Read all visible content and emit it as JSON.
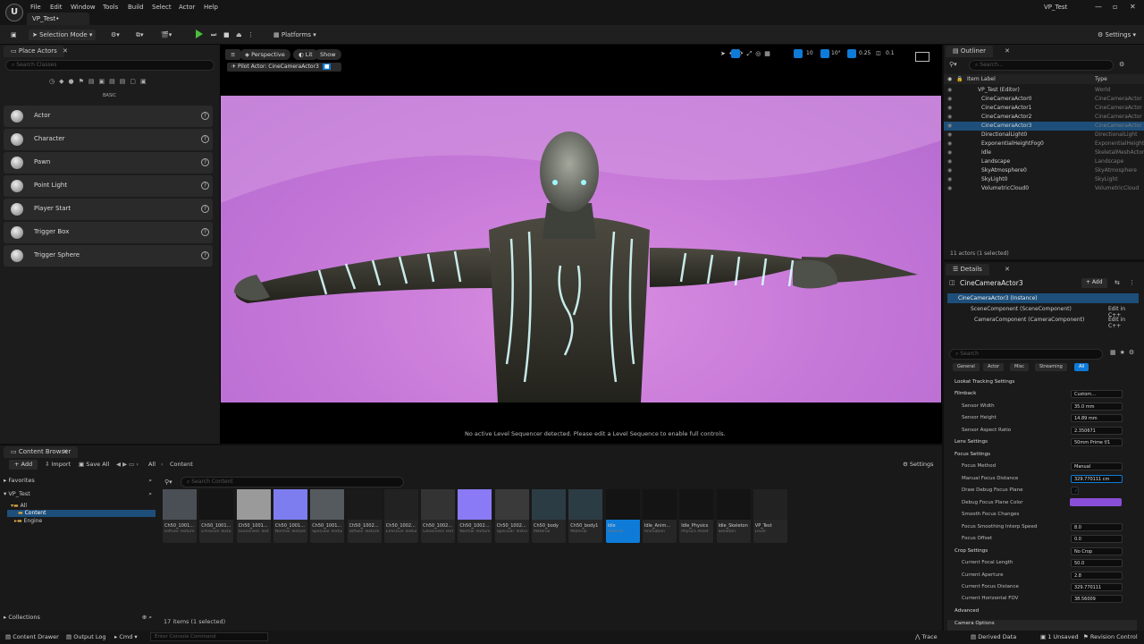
{
  "menu": [
    "File",
    "Edit",
    "Window",
    "Tools",
    "Build",
    "Select",
    "Actor",
    "Help"
  ],
  "project_tab": "VP_Test•",
  "window_title": "VP_Test",
  "toolbar": {
    "mode": "Selection Mode",
    "platforms": "Platforms",
    "settings": "Settings"
  },
  "place_actors": {
    "tab": "Place Actors",
    "search_placeholder": "Search Classes",
    "category": "BASIC",
    "items": [
      "Actor",
      "Character",
      "Pawn",
      "Point Light",
      "Player Start",
      "Trigger Box",
      "Trigger Sphere"
    ]
  },
  "viewport": {
    "perspective": "Perspective",
    "lit": "Lit",
    "show": "Show",
    "pilot": "Pilot Actor: CineCameraActor3",
    "grid": "10",
    "rot": "10°",
    "scale": "0.25",
    "cam": "0.1",
    "message": "No active Level Sequencer detected. Please edit a Level Sequence to enable full controls."
  },
  "outliner": {
    "tab": "Outliner",
    "search_placeholder": "Search...",
    "col_label": "Item Label",
    "col_type": "Type",
    "rows": [
      {
        "label": "VP_Test (Editor)",
        "type": "World"
      },
      {
        "label": "CineCameraActor0",
        "type": "CineCameraActor"
      },
      {
        "label": "CineCameraActor1",
        "type": "CineCameraActor"
      },
      {
        "label": "CineCameraActor2",
        "type": "CineCameraActor"
      },
      {
        "label": "CineCameraActor3",
        "type": "CineCameraActor"
      },
      {
        "label": "DirectionalLight0",
        "type": "DirectionalLight"
      },
      {
        "label": "ExponentialHeightFog0",
        "type": "ExponentialHeightFog"
      },
      {
        "label": "Idle",
        "type": "SkeletalMeshActor"
      },
      {
        "label": "Landscape",
        "type": "Landscape"
      },
      {
        "label": "SkyAtmosphere0",
        "type": "SkyAtmosphere"
      },
      {
        "label": "SkyLight0",
        "type": "SkyLight"
      },
      {
        "label": "VolumetricCloud0",
        "type": "VolumetricCloud"
      }
    ],
    "footer": "11 actors (1 selected)"
  },
  "details": {
    "tab": "Details",
    "actor": "CineCameraActor3",
    "add": "+ Add",
    "instance": "CineCameraActor3 (Instance)",
    "comp1": "SceneComponent (SceneComponent)",
    "comp2": "CameraComponent (CameraComponent)",
    "edit_cpp": "Edit in C++",
    "search_placeholder": "Search",
    "filters": [
      "General",
      "Actor",
      "Misc",
      "Streaming",
      "All"
    ],
    "rows": [
      {
        "label": "Lookat Tracking Settings",
        "value": ""
      },
      {
        "label": "Filmback",
        "value": "Custom..."
      },
      {
        "label": "Sensor Width",
        "value": "35.0 mm"
      },
      {
        "label": "Sensor Height",
        "value": "14.89 mm"
      },
      {
        "label": "Sensor Aspect Ratio",
        "value": "2.350671"
      },
      {
        "label": "Lens Settings",
        "value": "50mm Prime f/1"
      },
      {
        "label": "Focus Settings",
        "value": ""
      },
      {
        "label": "Focus Method",
        "value": "Manual"
      },
      {
        "label": "Manual Focus Distance",
        "value": "329.770111 cm"
      },
      {
        "label": "Draw Debug Focus Plane",
        "value": "✓"
      },
      {
        "label": "Debug Focus Plane Color",
        "value": ""
      },
      {
        "label": "Smooth Focus Changes",
        "value": ""
      },
      {
        "label": "Focus Smoothing Interp Speed",
        "value": "8.0"
      },
      {
        "label": "Focus Offset",
        "value": "0.0"
      },
      {
        "label": "Crop Settings",
        "value": "No Crop"
      },
      {
        "label": "Current Focal Length",
        "value": "50.0"
      },
      {
        "label": "Current Aperture",
        "value": "2.8"
      },
      {
        "label": "Current Focus Distance",
        "value": "329.770111"
      },
      {
        "label": "Current Horizontal FOV",
        "value": "38.56009"
      },
      {
        "label": "Advanced",
        "value": ""
      },
      {
        "label": "Camera Options",
        "value": ""
      }
    ]
  },
  "content_browser": {
    "tab": "Content Browser",
    "add": "+ Add",
    "import": "Import",
    "save_all": "Save All",
    "path_all": "All",
    "path_content": "Content",
    "settings": "Settings",
    "favorites": "Favorites",
    "project": "VP_Test",
    "tree": [
      "All",
      "Content",
      "Engine"
    ],
    "search_placeholder": "Search Content",
    "assets": [
      {
        "name": "Ch50_1001...",
        "sub": "Diffuse Texture"
      },
      {
        "name": "Ch50_1001...",
        "sub": "Emissive Texture"
      },
      {
        "name": "Ch50_1001...",
        "sub": "Glossiness Texture"
      },
      {
        "name": "Ch50_1001...",
        "sub": "Normal Texture"
      },
      {
        "name": "Ch50_1001...",
        "sub": "Specular Texture"
      },
      {
        "name": "Ch50_1002...",
        "sub": "Diffuse Texture"
      },
      {
        "name": "Ch50_1002...",
        "sub": "Emissive Texture"
      },
      {
        "name": "Ch50_1002...",
        "sub": "Glossiness Texture"
      },
      {
        "name": "Ch50_1002...",
        "sub": "Normal Texture"
      },
      {
        "name": "Ch50_1002...",
        "sub": "Specular Texture"
      },
      {
        "name": "Ch50_body",
        "sub": "Material"
      },
      {
        "name": "Ch50_body1",
        "sub": "Material"
      },
      {
        "name": "Idle",
        "sub": "Skeletal"
      },
      {
        "name": "Idle_Anim...",
        "sub": "Animation"
      },
      {
        "name": "Idle_Physics",
        "sub": "Physics Asset"
      },
      {
        "name": "Idle_Skeleton",
        "sub": "Skeleton"
      },
      {
        "name": "VP_Test",
        "sub": "Level"
      }
    ],
    "status": "17 items (1 selected)",
    "collections": "Collections"
  },
  "statusbar": {
    "drawer": "Content Drawer",
    "output": "Output Log",
    "cmd": "Cmd",
    "console_placeholder": "Enter Console Command",
    "trace": "Trace",
    "derived": "Derived Data",
    "unsaved": "1 Unsaved",
    "revision": "Revision Control"
  },
  "colors": {
    "accent": "#0e7bd8",
    "play": "#4cbc3c",
    "scene": "#c678d8",
    "focus_plane": "#8a4fd8"
  }
}
